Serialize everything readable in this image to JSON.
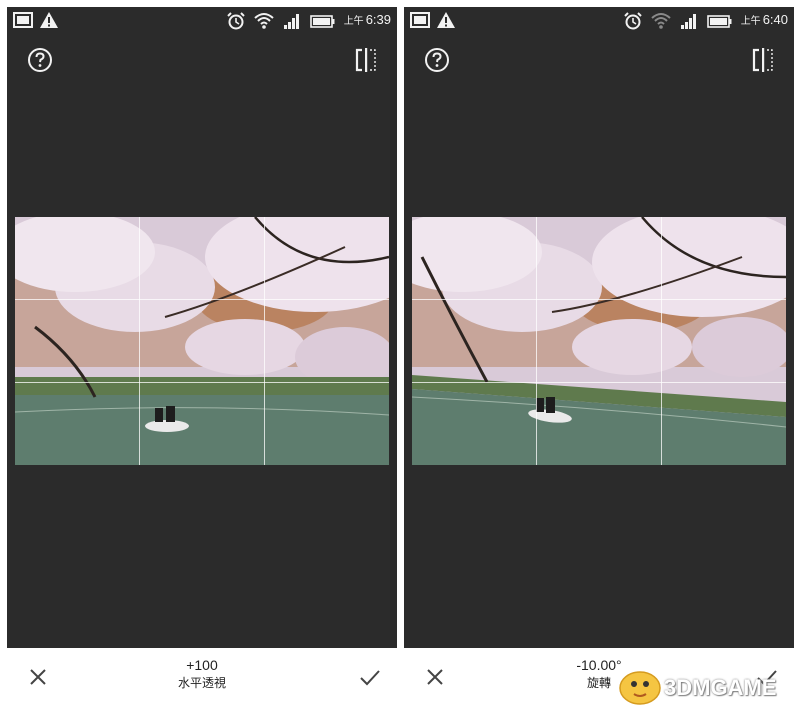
{
  "left_screen": {
    "status": {
      "ampm": "上午",
      "time": "6:39"
    },
    "adjust_value": "+100",
    "adjust_label": "水平透視"
  },
  "right_screen": {
    "status": {
      "ampm": "上午",
      "time": "6:40"
    },
    "adjust_value": "-10.00°",
    "adjust_label": "旋轉"
  },
  "icons": {
    "status_left": [
      "gallery-icon",
      "warning-icon"
    ],
    "status_right": [
      "alarm-icon",
      "wifi-icon",
      "signal-icon",
      "battery-icon"
    ],
    "toolbar": [
      "help-icon",
      "compare-icon"
    ],
    "bottom": [
      "close-icon",
      "check-icon"
    ]
  },
  "watermark": {
    "brand": "3DMGAME"
  },
  "colors": {
    "screen_bg": "#2b2b2b",
    "bottom_bar": "#ffffff",
    "icon_light": "#f2f2f2",
    "icon_dark": "#444444"
  }
}
